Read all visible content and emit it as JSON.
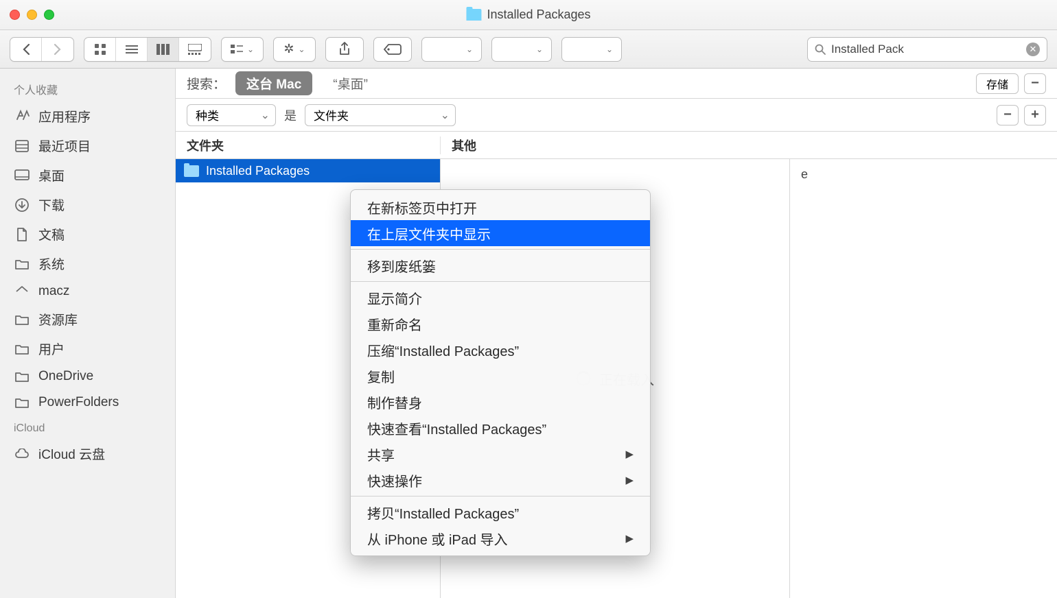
{
  "window": {
    "title": "Installed Packages"
  },
  "search": {
    "value": "Installed Pack"
  },
  "sidebar": {
    "sections": [
      {
        "title": "个人收藏",
        "items": [
          {
            "icon": "applications",
            "label": "应用程序"
          },
          {
            "icon": "recent",
            "label": "最近项目"
          },
          {
            "icon": "desktop",
            "label": "桌面"
          },
          {
            "icon": "downloads",
            "label": "下载"
          },
          {
            "icon": "documents",
            "label": "文稿"
          },
          {
            "icon": "folder",
            "label": "系统"
          },
          {
            "icon": "home",
            "label": "macz"
          },
          {
            "icon": "folder",
            "label": "资源库"
          },
          {
            "icon": "folder",
            "label": "用户"
          },
          {
            "icon": "folder",
            "label": "OneDrive"
          },
          {
            "icon": "folder",
            "label": "PowerFolders"
          }
        ]
      },
      {
        "title": "iCloud",
        "items": [
          {
            "icon": "cloud",
            "label": "iCloud 云盘"
          }
        ]
      }
    ]
  },
  "scope": {
    "label": "搜索：",
    "pills": [
      "这台 Mac",
      "“桌面”"
    ],
    "save": "存储"
  },
  "filter": {
    "attribute": "种类",
    "is": "是",
    "value": "文件夹"
  },
  "columns": {
    "col1": "文件夹",
    "col2": "其他"
  },
  "results": [
    {
      "name": "Installed Packages"
    }
  ],
  "preview": {
    "loading": "正在载入"
  },
  "other_text": "e",
  "context_menu": {
    "items": [
      {
        "label": "在新标签页中打开"
      },
      {
        "label": "在上层文件夹中显示",
        "highlighted": true
      },
      {
        "sep": true
      },
      {
        "label": "移到废纸篓"
      },
      {
        "sep": true
      },
      {
        "label": "显示简介"
      },
      {
        "label": "重新命名"
      },
      {
        "label": "压缩“Installed Packages”"
      },
      {
        "label": "复制"
      },
      {
        "label": "制作替身"
      },
      {
        "label": "快速查看“Installed Packages”"
      },
      {
        "label": "共享",
        "submenu": true
      },
      {
        "label": "快速操作",
        "submenu": true
      },
      {
        "sep": true
      },
      {
        "label": "拷贝“Installed Packages”"
      },
      {
        "label": "从 iPhone 或 iPad 导入",
        "submenu": true
      }
    ]
  }
}
